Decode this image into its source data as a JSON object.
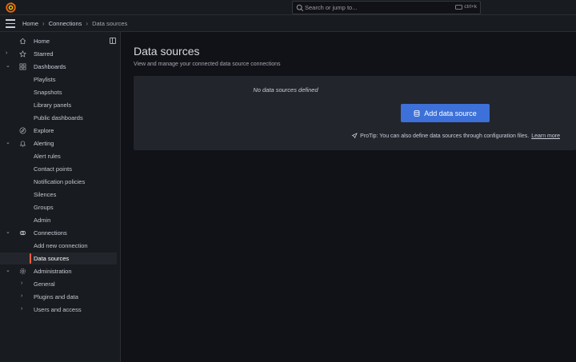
{
  "search": {
    "placeholder": "Search or jump to...",
    "shortcut": "ctrl+k"
  },
  "breadcrumb": {
    "items": [
      "Home",
      "Connections"
    ],
    "current": "Data sources"
  },
  "sidebar": {
    "items": [
      {
        "label": "Home",
        "icon": "home-icon"
      },
      {
        "label": "Starred",
        "icon": "star-icon"
      },
      {
        "label": "Dashboards",
        "icon": "apps-icon"
      },
      {
        "label": "Playlists"
      },
      {
        "label": "Snapshots"
      },
      {
        "label": "Library panels"
      },
      {
        "label": "Public dashboards"
      },
      {
        "label": "Explore",
        "icon": "compass-icon"
      },
      {
        "label": "Alerting",
        "icon": "bell-icon"
      },
      {
        "label": "Alert rules"
      },
      {
        "label": "Contact points"
      },
      {
        "label": "Notification policies"
      },
      {
        "label": "Silences"
      },
      {
        "label": "Groups"
      },
      {
        "label": "Admin"
      },
      {
        "label": "Connections",
        "icon": "link-icon"
      },
      {
        "label": "Add new connection"
      },
      {
        "label": "Data sources"
      },
      {
        "label": "Administration",
        "icon": "cog-icon"
      },
      {
        "label": "General"
      },
      {
        "label": "Plugins and data"
      },
      {
        "label": "Users and access"
      }
    ]
  },
  "main": {
    "title": "Data sources",
    "subtitle": "View and manage your connected data source connections",
    "empty_text": "No data sources defined",
    "add_button": "Add data source",
    "protip": "ProTip: You can also define data sources through configuration files.",
    "learn_more": "Learn more"
  },
  "colors": {
    "accent": "#3d71d9",
    "active_marker": "#f55f3e",
    "brand": "#f46800"
  }
}
